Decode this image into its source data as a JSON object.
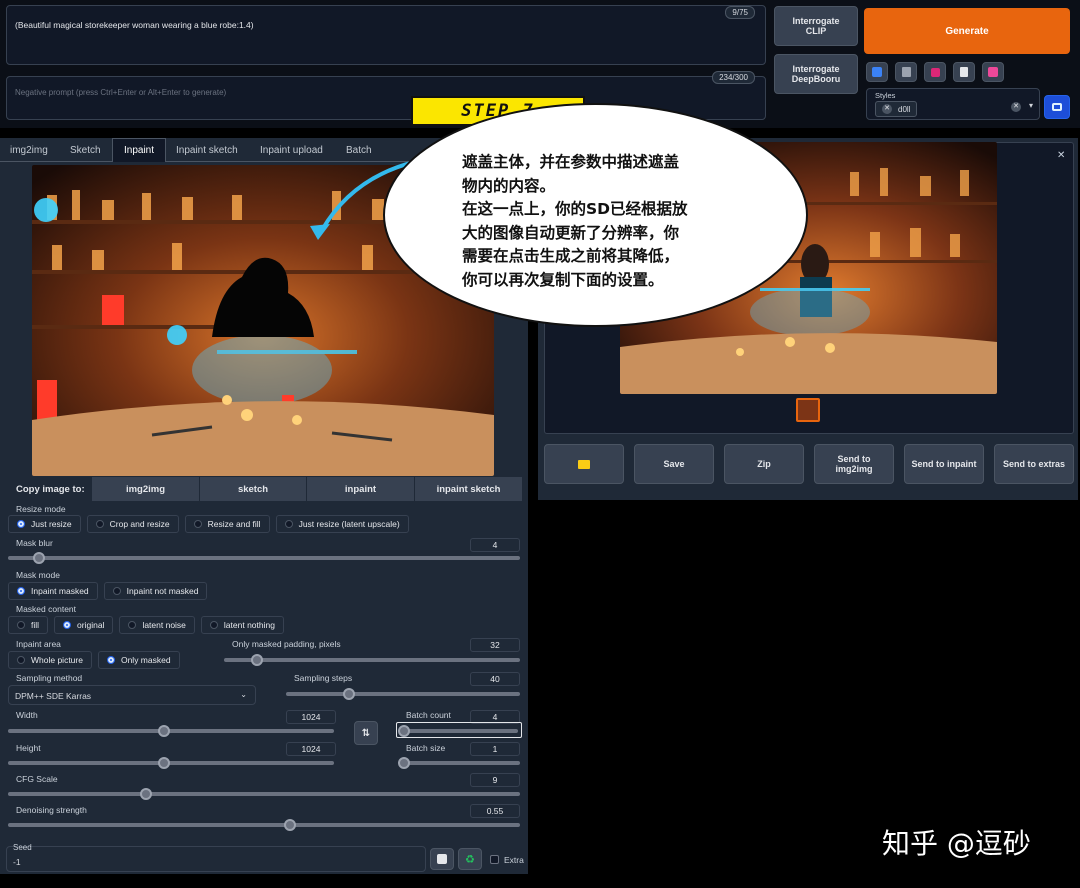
{
  "prompt": {
    "text": "(Beautiful magical storekeeper woman wearing a blue robe:1.4)",
    "counter": "9/75"
  },
  "negative_prompt": {
    "placeholder": "Negative prompt (press Ctrl+Enter or Alt+Enter to generate)",
    "counter": "234/300"
  },
  "interrogate": {
    "clip": "Interrogate\nCLIP",
    "deepbooru": "Interrogate\nDeepBooru"
  },
  "generate_label": "Generate",
  "tool_icons": [
    "checkbox-icon",
    "trash-icon",
    "magic-icon",
    "clipboard-icon",
    "save-icon"
  ],
  "styles": {
    "label": "Styles",
    "chip": "d0ll"
  },
  "step_banner": "STEP 7",
  "callout": {
    "line1": "遮盖主体，并在参数中描述遮盖",
    "line2": "物内的内容。",
    "line3": "在这一点上，你的SD已经根据放",
    "line4": "大的图像自动更新了分辨率，你",
    "line5": "需要在点击生成之前将其降低，",
    "line6": "你可以再次复制下面的设置。"
  },
  "tabs": [
    "img2img",
    "Sketch",
    "Inpaint",
    "Inpaint sketch",
    "Inpaint upload",
    "Batch"
  ],
  "copy_image": {
    "label": "Copy image to:",
    "targets": [
      "img2img",
      "sketch",
      "inpaint",
      "inpaint sketch"
    ]
  },
  "resize_mode": {
    "label": "Resize mode",
    "options": [
      "Just resize",
      "Crop and resize",
      "Resize and fill",
      "Just resize (latent upscale)"
    ]
  },
  "mask_blur": {
    "label": "Mask blur",
    "value": "4"
  },
  "mask_mode": {
    "label": "Mask mode",
    "options": [
      "Inpaint masked",
      "Inpaint not masked"
    ]
  },
  "masked_content": {
    "label": "Masked content",
    "options": [
      "fill",
      "original",
      "latent noise",
      "latent nothing"
    ]
  },
  "inpaint_area": {
    "label": "Inpaint area",
    "options": [
      "Whole picture",
      "Only masked"
    ]
  },
  "only_masked_padding": {
    "label": "Only masked padding, pixels",
    "value": "32"
  },
  "sampling_method": {
    "label": "Sampling method",
    "value": "DPM++ SDE Karras"
  },
  "sampling_steps": {
    "label": "Sampling steps",
    "value": "40"
  },
  "width": {
    "label": "Width",
    "value": "1024"
  },
  "height": {
    "label": "Height",
    "value": "1024"
  },
  "batch_count": {
    "label": "Batch count",
    "value": "4"
  },
  "batch_size": {
    "label": "Batch size",
    "value": "1"
  },
  "cfg_scale": {
    "label": "CFG Scale",
    "value": "9"
  },
  "denoising": {
    "label": "Denoising strength",
    "value": "0.55"
  },
  "seed": {
    "label": "Seed",
    "value": "-1",
    "extra": "Extra"
  },
  "output_actions": [
    "Save",
    "Zip",
    "Send to\nimg2img",
    "Send to inpaint",
    "Send to extras"
  ],
  "watermark": "知乎 @逗砂",
  "slider_levels": {
    "mask_blur": 0.06,
    "padding": 0.11,
    "steps": 0.27,
    "width": 0.48,
    "height": 0.48,
    "batch_count": 0.03,
    "batch_size": 0.03,
    "cfg": 0.27,
    "denoise": 0.55
  }
}
